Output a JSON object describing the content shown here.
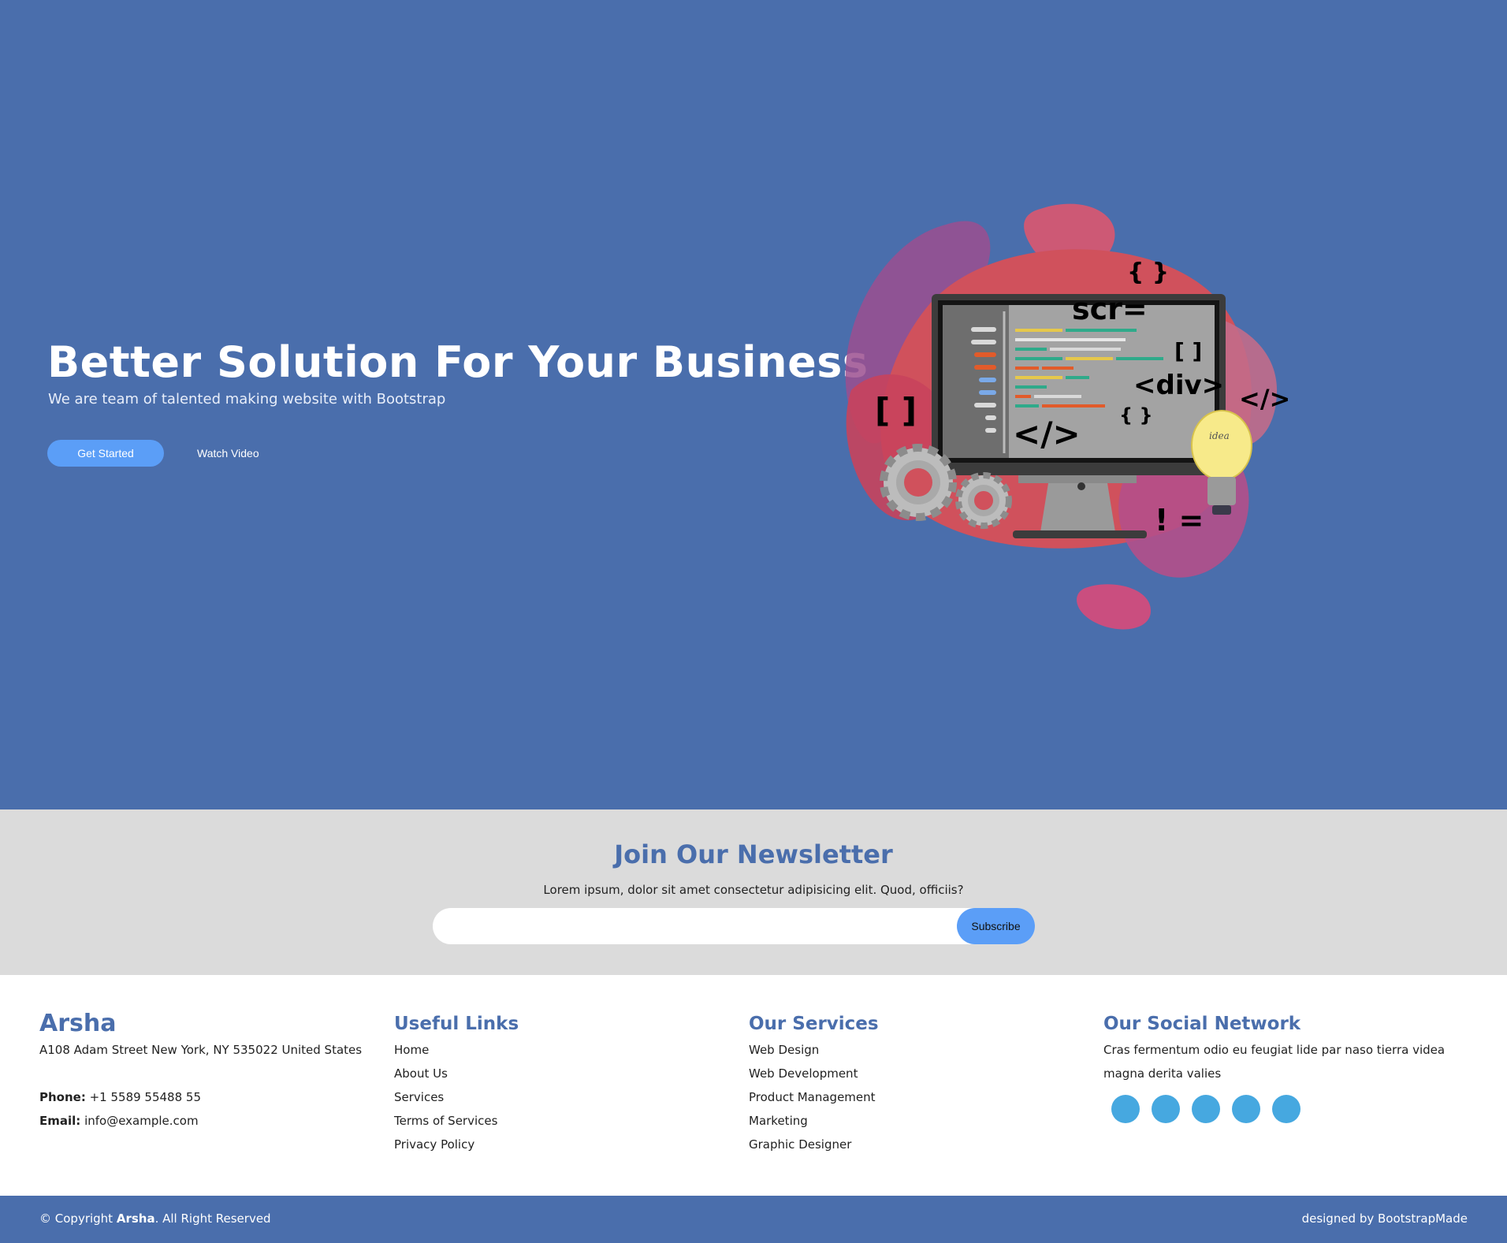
{
  "colors": {
    "primary": "#4a6eac",
    "accent": "#5b9ef7",
    "newsletter_bg": "#dbdbdb",
    "social": "#46a8e0"
  },
  "hero": {
    "title": "Better Solution For Your Business",
    "subtitle": "We are team of talented making website with Bootstrap",
    "get_started": "Get Started",
    "watch_video": "Watch Video",
    "illustration": {
      "screen_code": "scr=",
      "brackets_top": "{ }",
      "brackets_square_right": "[ ]",
      "div_tag": "<div>",
      "brackets_curly_small": "{ }",
      "close_tag_screen": "</>",
      "brackets_square_left": "[ ]",
      "close_tag_right": "</>",
      "not_equal": "! =",
      "bulb_text": "idea"
    }
  },
  "newsletter": {
    "title": "Join Our Newsletter",
    "text": "Lorem ipsum, dolor sit amet consectetur adipisicing elit. Quod, officiis?",
    "placeholder": "",
    "button": "Subscribe"
  },
  "footer": {
    "brand": "Arsha",
    "address": "A108 Adam Street New York, NY 535022 United States",
    "phone_label": "Phone:",
    "phone": "+1 5589 55488 55",
    "email_label": "Email:",
    "email": "info@example.com",
    "useful_links_title": "Useful Links",
    "useful_links": [
      "Home",
      "About Us",
      "Services",
      "Terms of Services",
      "Privacy Policy"
    ],
    "services_title": "Our Services",
    "services": [
      "Web Design",
      "Web Development",
      "Product Management",
      "Marketing",
      "Graphic Designer"
    ],
    "social_title": "Our Social Network",
    "social_text": "Cras fermentum odio eu feugiat lide par naso tierra videa magna derita valies",
    "social_icons": [
      "twitter-icon",
      "facebook-icon",
      "instagram-icon",
      "skype-icon",
      "linkedin-icon"
    ],
    "copyright_prefix": "© Copyright",
    "copyright_brand": "Arsha",
    "copyright_suffix": ". All Right Reserved",
    "credits": "designed by BootstrapMade"
  }
}
